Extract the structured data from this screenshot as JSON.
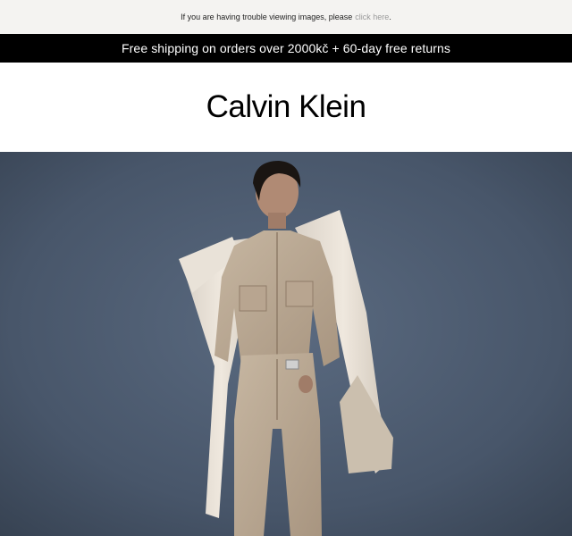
{
  "preheader": {
    "text": "If you are having trouble viewing images, please",
    "link_label": "click here",
    "suffix": "."
  },
  "promo": {
    "text": "Free shipping on orders over 2000kč + 60-day free returns"
  },
  "brand": {
    "logo_text": "Calvin Klein"
  },
  "colors": {
    "promo_bg": "#000000",
    "preheader_bg": "#f4f3f1",
    "link": "#9a9a9a",
    "hero_bg": "#48566a"
  }
}
